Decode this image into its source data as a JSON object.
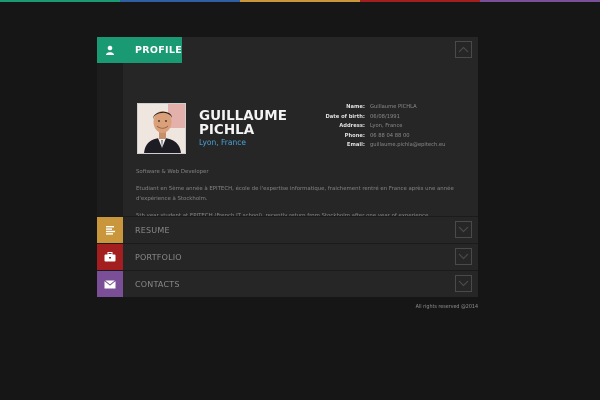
{
  "colors": {
    "profile": "#1a9a72",
    "resume": "#c9963b",
    "portfolio": "#a31e1e",
    "contacts": "#7b4f97",
    "topbar": [
      "#1a9a72",
      "#2f5fa0",
      "#c9963b",
      "#a31e1e",
      "#7b4f97"
    ]
  },
  "profile": {
    "label": "PROFILE",
    "icon": "person-icon",
    "name": "GUILLAUME PICHLA",
    "city": "Lyon, France",
    "info": [
      {
        "key": "Name:",
        "value": "Guillaume PICHLA"
      },
      {
        "key": "Date of birth:",
        "value": "06/08/1991"
      },
      {
        "key": "Address:",
        "value": "Lyon, France"
      },
      {
        "key": "Phone:",
        "value": "06 88 04 88 00"
      },
      {
        "key": "Email:",
        "value": "guillaume.pichla@epitech.eu"
      }
    ],
    "description": [
      "Software & Web Developer",
      "Etudiant en 5ème année à EPITECH, école de l'expertise informatique, fraichement rentré en France après une année d'expérience à Stockholm.",
      "5th year student at EPITECH (French IT school), recently return from Stockholm after one year of experience."
    ]
  },
  "sections": [
    {
      "id": "resume",
      "label": "RESUME",
      "icon": "document-lines-icon"
    },
    {
      "id": "portfolio",
      "label": "PORTFOLIO",
      "icon": "briefcase-icon"
    },
    {
      "id": "contacts",
      "label": "CONTACTS",
      "icon": "envelope-icon"
    }
  ],
  "footer": "All rights reserved @2014"
}
